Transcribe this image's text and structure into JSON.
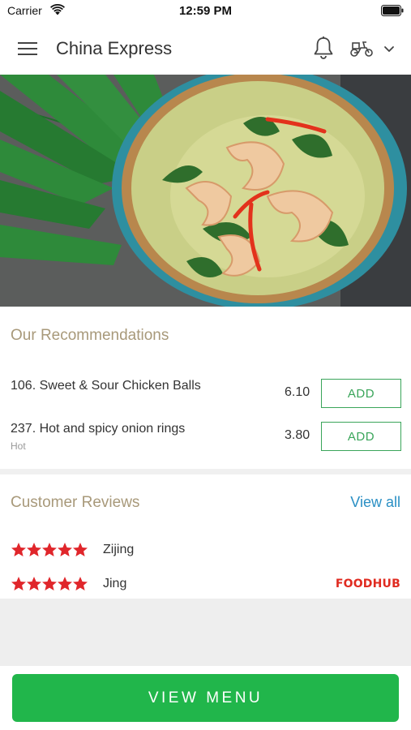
{
  "status_bar": {
    "carrier": "Carrier",
    "time": "12:59 PM"
  },
  "header": {
    "restaurant_name": "China Express",
    "icons": [
      "menu-icon",
      "bell-icon",
      "scooter-icon",
      "chevron-down-icon"
    ]
  },
  "hero": {
    "description_icon": "food-photo"
  },
  "recommendations": {
    "title": "Our Recommendations",
    "items": [
      {
        "name": "106. Sweet & Sour Chicken Balls",
        "subtitle": "",
        "price": "6.10",
        "button": "ADD"
      },
      {
        "name": "237. Hot and spicy onion rings",
        "subtitle": "Hot",
        "price": "3.80",
        "button": "ADD"
      }
    ]
  },
  "reviews": {
    "title": "Customer Reviews",
    "view_all": "View all",
    "items": [
      {
        "reviewer": "Zijing",
        "rating": 5
      },
      {
        "reviewer": "Jing",
        "rating": 5
      }
    ],
    "source_logo": "FOODHUB"
  },
  "footer": {
    "view_menu": "VIEW MENU"
  },
  "colors": {
    "accent_green": "#21b64b",
    "add_green": "#3aa55a",
    "section_title": "#a8997a",
    "link_blue": "#2a8fc4",
    "star_red": "#e0262b",
    "foodhub_red": "#e02b20"
  }
}
